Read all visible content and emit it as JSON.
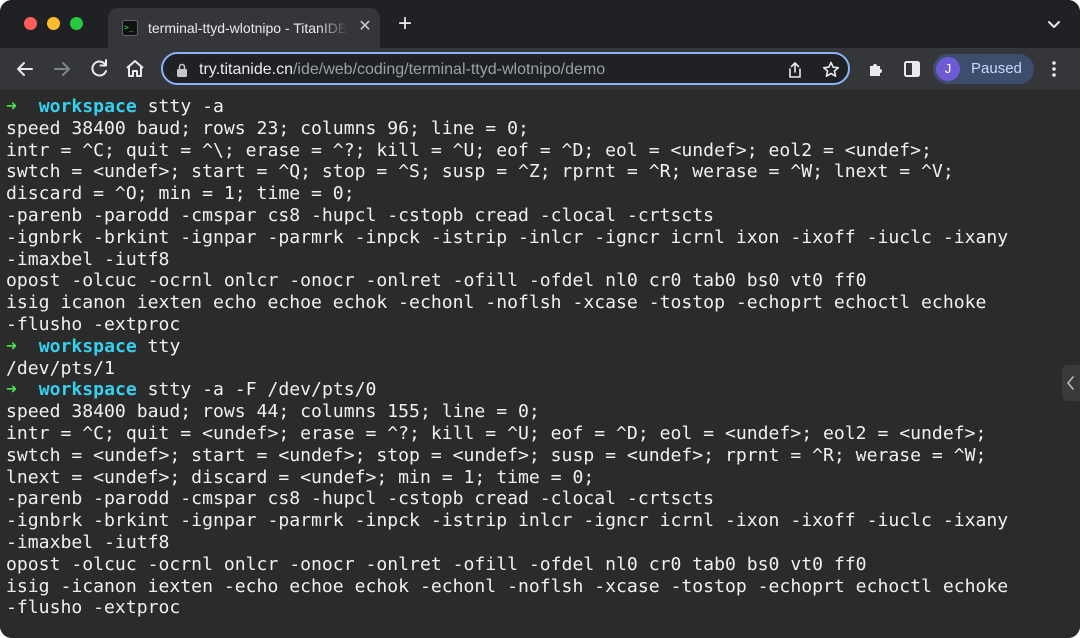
{
  "browser": {
    "tab": {
      "title": "terminal-ttyd-wlotnipo - TitanIDE",
      "favicon_text": ">_"
    },
    "address": {
      "host": "try.titanide.cn",
      "path": "/ide/web/coding/terminal-ttyd-wlotnipo/demo"
    },
    "profile": {
      "initial": "J",
      "status": "Paused"
    },
    "icons": [
      "back-icon",
      "forward-icon",
      "reload-icon",
      "home-icon",
      "lock-icon",
      "share-icon",
      "bookmark-star-icon",
      "extensions-icon",
      "side-panel-icon",
      "menu-icon",
      "tab-search-icon",
      "close-icon",
      "new-tab-icon"
    ]
  },
  "terminal": {
    "prompt_symbol": "➜",
    "lines": [
      {
        "type": "prompt",
        "dir": "workspace",
        "cmd": "stty -a"
      },
      {
        "type": "out",
        "text": "speed 38400 baud; rows 23; columns 96; line = 0;"
      },
      {
        "type": "out",
        "text": "intr = ^C; quit = ^\\; erase = ^?; kill = ^U; eof = ^D; eol = <undef>; eol2 = <undef>;"
      },
      {
        "type": "out",
        "text": "swtch = <undef>; start = ^Q; stop = ^S; susp = ^Z; rprnt = ^R; werase = ^W; lnext = ^V;"
      },
      {
        "type": "out",
        "text": "discard = ^O; min = 1; time = 0;"
      },
      {
        "type": "out",
        "text": "-parenb -parodd -cmspar cs8 -hupcl -cstopb cread -clocal -crtscts"
      },
      {
        "type": "out",
        "text": "-ignbrk -brkint -ignpar -parmrk -inpck -istrip -inlcr -igncr icrnl ixon -ixoff -iuclc -ixany"
      },
      {
        "type": "out",
        "text": "-imaxbel -iutf8"
      },
      {
        "type": "out",
        "text": "opost -olcuc -ocrnl onlcr -onocr -onlret -ofill -ofdel nl0 cr0 tab0 bs0 vt0 ff0"
      },
      {
        "type": "out",
        "text": "isig icanon iexten echo echoe echok -echonl -noflsh -xcase -tostop -echoprt echoctl echoke"
      },
      {
        "type": "out",
        "text": "-flusho -extproc"
      },
      {
        "type": "prompt",
        "dir": "workspace",
        "cmd": "tty"
      },
      {
        "type": "out",
        "text": "/dev/pts/1"
      },
      {
        "type": "prompt",
        "dir": "workspace",
        "cmd": "stty -a -F /dev/pts/0"
      },
      {
        "type": "out",
        "text": "speed 38400 baud; rows 44; columns 155; line = 0;"
      },
      {
        "type": "out",
        "text": "intr = ^C; quit = <undef>; erase = ^?; kill = ^U; eof = ^D; eol = <undef>; eol2 = <undef>;"
      },
      {
        "type": "out",
        "text": "swtch = <undef>; start = <undef>; stop = <undef>; susp = <undef>; rprnt = ^R; werase = ^W;"
      },
      {
        "type": "out",
        "text": "lnext = <undef>; discard = <undef>; min = 1; time = 0;"
      },
      {
        "type": "out",
        "text": "-parenb -parodd -cmspar cs8 -hupcl -cstopb cread -clocal -crtscts"
      },
      {
        "type": "out",
        "text": "-ignbrk -brkint -ignpar -parmrk -inpck -istrip inlcr -igncr icrnl -ixon -ixoff -iuclc -ixany"
      },
      {
        "type": "out",
        "text": "-imaxbel -iutf8"
      },
      {
        "type": "out",
        "text": "opost -olcuc -ocrnl onlcr -onocr -onlret -ofill -ofdel nl0 cr0 tab0 bs0 vt0 ff0"
      },
      {
        "type": "out",
        "text": "isig -icanon iexten -echo echoe echok -echonl -noflsh -xcase -tostop -echoprt echoctl echoke"
      },
      {
        "type": "out",
        "text": "-flusho -extproc"
      }
    ]
  },
  "colors": {
    "tab_strip": "#202124",
    "toolbar": "#35363a",
    "terminal_bg": "#2b2b2b",
    "prompt_arrow": "#4be04b",
    "prompt_dir": "#35d0f0",
    "omnibox_focus": "#8ab4f8"
  }
}
